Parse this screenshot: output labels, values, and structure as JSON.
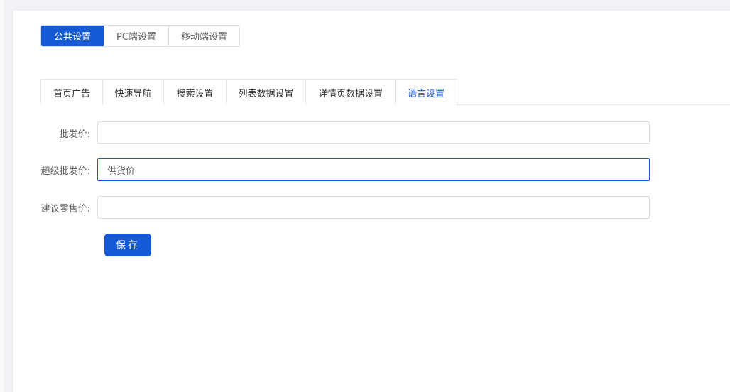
{
  "platform_tabs": [
    {
      "label": "公共设置",
      "active": true
    },
    {
      "label": "PC端设置"
    },
    {
      "label": "移动端设置"
    }
  ],
  "sub_tabs": [
    {
      "label": "首页广告"
    },
    {
      "label": "快速导航"
    },
    {
      "label": "搜索设置"
    },
    {
      "label": "列表数据设置"
    },
    {
      "label": "详情页数据设置"
    },
    {
      "label": "语言设置",
      "active": true
    }
  ],
  "form": {
    "fields": [
      {
        "label": "批发价:",
        "value": ""
      },
      {
        "label": "超级批发价:",
        "value": "供货价"
      },
      {
        "label": "建议零售价:",
        "value": ""
      }
    ],
    "save_label": "保存"
  },
  "colors": {
    "accent": "#1559d6"
  }
}
